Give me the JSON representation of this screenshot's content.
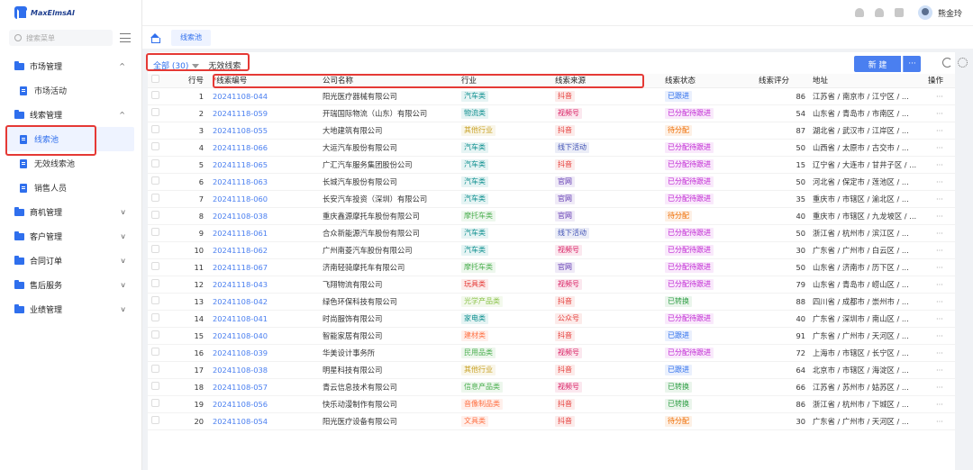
{
  "app": {
    "logo_text": "MaxElmsAI"
  },
  "sidebar": {
    "search_placeholder": "搜索菜单",
    "groups": [
      {
        "label": "市场管理",
        "chevron": "^"
      },
      {
        "label": "线索管理",
        "chevron": "^"
      },
      {
        "label": "商机管理",
        "chevron": "v"
      },
      {
        "label": "客户管理",
        "chevron": "v"
      },
      {
        "label": "合同订单",
        "chevron": "v"
      },
      {
        "label": "售后服务",
        "chevron": "v"
      },
      {
        "label": "业绩管理",
        "chevron": "v"
      }
    ],
    "items": {
      "market_activity": "市场活动",
      "lead_pool": "线索池",
      "invalid_leads": "无效线索池",
      "sales_staff": "销售人员"
    }
  },
  "topbar": {
    "username": "熊金玲"
  },
  "tabs": {
    "active": "线索池"
  },
  "toolbar": {
    "filter_all": "全部 (30)",
    "filter_invalid": "无效线索",
    "new_button": "新 建",
    "more_button": "···"
  },
  "table": {
    "columns": {
      "rownum": "行号",
      "code": "线索编号",
      "company": "公司名称",
      "industry": "行业",
      "source": "线索来源",
      "status": "线索状态",
      "score": "线索评分",
      "address": "地址",
      "ops": "操作"
    },
    "rows": [
      {
        "n": "1",
        "code": "20241108-044",
        "company": "阳光医疗器械有限公司",
        "industry": "汽车类",
        "source": "抖音",
        "status": "已跟进",
        "score": "86",
        "address": "江苏省 / 南京市 / 江宁区 / ..."
      },
      {
        "n": "2",
        "code": "20241118-059",
        "company": "开瑞国际物流（山东）有限公司",
        "industry": "物流类",
        "source": "视频号",
        "status": "已分配待跟进",
        "score": "54",
        "address": "山东省 / 青岛市 / 市南区 / ..."
      },
      {
        "n": "3",
        "code": "20241108-055",
        "company": "大地建筑有限公司",
        "industry": "其他行业",
        "source": "抖音",
        "status": "待分配",
        "score": "87",
        "address": "湖北省 / 武汉市 / 江岸区 / ..."
      },
      {
        "n": "4",
        "code": "20241118-066",
        "company": "大运汽车股份有限公司",
        "industry": "汽车类",
        "source": "线下活动",
        "status": "已分配待跟进",
        "score": "50",
        "address": "山西省 / 太原市 / 古交市 / ..."
      },
      {
        "n": "5",
        "code": "20241118-065",
        "company": "广汇汽车服务集团股份公司",
        "industry": "汽车类",
        "source": "抖音",
        "status": "已分配待跟进",
        "score": "15",
        "address": "辽宁省 / 大连市 / 甘井子区 / ..."
      },
      {
        "n": "6",
        "code": "20241118-063",
        "company": "长城汽车股份有限公司",
        "industry": "汽车类",
        "source": "官网",
        "status": "已分配待跟进",
        "score": "50",
        "address": "河北省 / 保定市 / 莲池区 / ..."
      },
      {
        "n": "7",
        "code": "20241118-060",
        "company": "长安汽车投资（深圳）有限公司",
        "industry": "汽车类",
        "source": "官网",
        "status": "已分配待跟进",
        "score": "35",
        "address": "重庆市 / 市辖区 / 渝北区 / ..."
      },
      {
        "n": "8",
        "code": "20241108-038",
        "company": "重庆鑫源摩托车股份有限公司",
        "industry": "摩托车类",
        "source": "官网",
        "status": "待分配",
        "score": "40",
        "address": "重庆市 / 市辖区 / 九龙坡区 / ..."
      },
      {
        "n": "9",
        "code": "20241118-061",
        "company": "合众新能源汽车股份有限公司",
        "industry": "汽车类",
        "source": "线下活动",
        "status": "已分配待跟进",
        "score": "50",
        "address": "浙江省 / 杭州市 / 滨江区 / ..."
      },
      {
        "n": "10",
        "code": "20241118-062",
        "company": "广州南菱汽车股份有限公司",
        "industry": "汽车类",
        "source": "视频号",
        "status": "已分配待跟进",
        "score": "30",
        "address": "广东省 / 广州市 / 白云区 / ..."
      },
      {
        "n": "11",
        "code": "20241118-067",
        "company": "济南轻骑摩托车有限公司",
        "industry": "摩托车类",
        "source": "官网",
        "status": "已分配待跟进",
        "score": "50",
        "address": "山东省 / 济南市 / 历下区 / ..."
      },
      {
        "n": "12",
        "code": "20241118-043",
        "company": "飞翔物流有限公司",
        "industry": "玩具类",
        "source": "视频号",
        "status": "已分配待跟进",
        "score": "79",
        "address": "山东省 / 青岛市 / 崂山区 / ..."
      },
      {
        "n": "13",
        "code": "20241108-042",
        "company": "绿色环保科技有限公司",
        "industry": "光学产品类",
        "source": "抖音",
        "status": "已转换",
        "score": "88",
        "address": "四川省 / 成都市 / 崇州市 / ..."
      },
      {
        "n": "14",
        "code": "20241108-041",
        "company": "时尚服饰有限公司",
        "industry": "家电类",
        "source": "公众号",
        "status": "已分配待跟进",
        "score": "40",
        "address": "广东省 / 深圳市 / 南山区 / ..."
      },
      {
        "n": "15",
        "code": "20241108-040",
        "company": "智能家居有限公司",
        "industry": "建材类",
        "source": "抖音",
        "status": "已跟进",
        "score": "91",
        "address": "广东省 / 广州市 / 天河区 / ..."
      },
      {
        "n": "16",
        "code": "20241108-039",
        "company": "华美设计事务所",
        "industry": "民用品类",
        "source": "视频号",
        "status": "已分配待跟进",
        "score": "72",
        "address": "上海市 / 市辖区 / 长宁区 / ..."
      },
      {
        "n": "17",
        "code": "20241108-038",
        "company": "明星科技有限公司",
        "industry": "其他行业",
        "source": "抖音",
        "status": "已跟进",
        "score": "64",
        "address": "北京市 / 市辖区 / 海淀区 / ..."
      },
      {
        "n": "18",
        "code": "20241108-057",
        "company": "青云信息技术有限公司",
        "industry": "信息产品类",
        "source": "视频号",
        "status": "已转换",
        "score": "66",
        "address": "江苏省 / 苏州市 / 姑苏区 / ..."
      },
      {
        "n": "19",
        "code": "20241108-056",
        "company": "快乐动漫制作有限公司",
        "industry": "音像制品类",
        "source": "抖音",
        "status": "已转换",
        "score": "86",
        "address": "浙江省 / 杭州市 / 下城区 / ..."
      },
      {
        "n": "20",
        "code": "20241108-054",
        "company": "阳光医疗设备有限公司",
        "industry": "文具类",
        "source": "抖音",
        "status": "待分配",
        "score": "30",
        "address": "广东省 / 广州市 / 天河区 / ..."
      }
    ]
  },
  "colors": {
    "industry": {
      "汽车类": "#0e8f8f",
      "物流类": "#0e8f8f",
      "其他行业": "#c9a227",
      "摩托车类": "#4caf50",
      "玩具类": "#e53935",
      "光学产品类": "#8bc34a",
      "家电类": "#0e8f8f",
      "建材类": "#ff7043",
      "民用品类": "#4caf50",
      "信息产品类": "#4caf50",
      "音像制品类": "#ff7043",
      "文具类": "#ff7043"
    },
    "source": {
      "抖音": "#e53935",
      "视频号": "#d81b60",
      "线下活动": "#3f51b5",
      "官网": "#5e35b1",
      "公众号": "#e53935"
    },
    "status": {
      "已跟进": "#2f6fed",
      "已分配待跟进": "#c026d3",
      "待分配": "#ef6c00",
      "已转换": "#2e9e44"
    }
  }
}
